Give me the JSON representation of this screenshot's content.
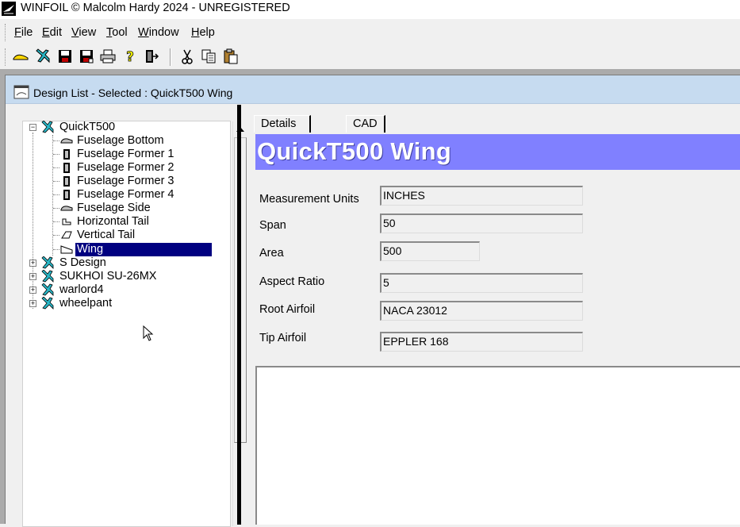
{
  "window": {
    "title": "WINFOIL © Malcolm Hardy 2024 - UNREGISTERED"
  },
  "menu": [
    {
      "key": "F",
      "rest": "ile"
    },
    {
      "key": "E",
      "rest": "dit"
    },
    {
      "key": "V",
      "rest": "iew"
    },
    {
      "key": "T",
      "rest": "ool"
    },
    {
      "key": "W",
      "rest": "indow"
    },
    {
      "key": "H",
      "rest": "elp"
    }
  ],
  "toolbar": {
    "icons": [
      "airfoil-icon",
      "plane-icon",
      "save-icon",
      "save-as-icon",
      "print-icon",
      "help-icon",
      "exit-icon",
      "cut-icon",
      "copy-icon",
      "paste-icon"
    ]
  },
  "child_window": {
    "title": "Design List - Selected : QuickT500 Wing"
  },
  "tree": {
    "root": "QuickT500",
    "children": [
      "Fuselage Bottom",
      "Fuselage Former 1",
      "Fuselage Former 2",
      "Fuselage Former 3",
      "Fuselage Former 4",
      "Fuselage Side",
      "Horizontal Tail",
      "Vertical Tail",
      "Wing"
    ],
    "selected": "Wing",
    "others": [
      "S Design",
      "SUKHOI SU-26MX",
      "warlord4",
      "wheelpant"
    ]
  },
  "tabs": [
    "Details",
    "CAD"
  ],
  "details": {
    "heading": "QuickT500 Wing",
    "fields": [
      {
        "label": "Measurement Units",
        "value": "INCHES"
      },
      {
        "label": "Span",
        "value": "50"
      },
      {
        "label": "Area",
        "value": "500"
      },
      {
        "label": "Aspect Ratio",
        "value": "5"
      },
      {
        "label": "Root Airfoil",
        "value": "NACA 23012"
      },
      {
        "label": "Tip Airfoil",
        "value": "EPPLER 168"
      }
    ]
  },
  "colors": {
    "heading_bar": "#8080ff",
    "selection": "#000080",
    "child_title": "#c6dbf0"
  }
}
